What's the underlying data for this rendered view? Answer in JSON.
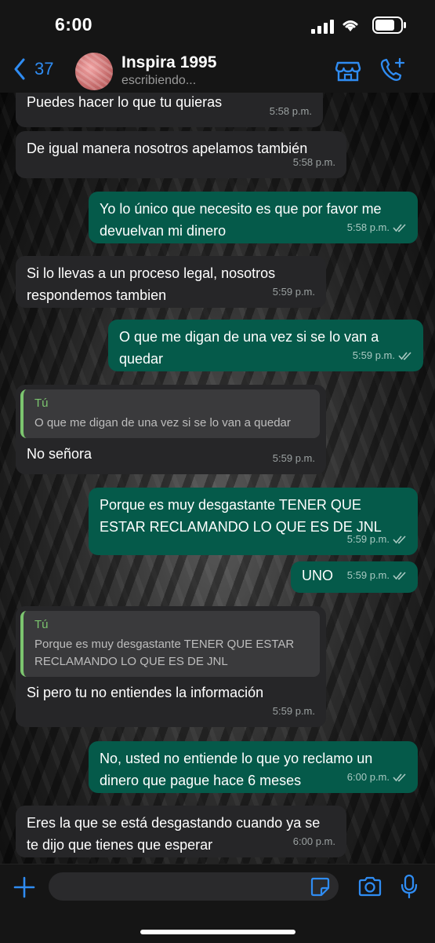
{
  "status_bar": {
    "time": "6:00"
  },
  "header": {
    "back_count": "37",
    "contact_name": "Inspira 1995",
    "contact_status": "escribiendo..."
  },
  "messages": [
    {
      "dir": "in",
      "text": "Puedes hacer lo que tu quieras",
      "time": "5:58 p.m."
    },
    {
      "dir": "in",
      "text": "De igual manera nosotros apelamos también",
      "time": "5:58 p.m."
    },
    {
      "dir": "out",
      "text": "Yo lo único que necesito es que por favor me devuelvan mi dinero",
      "time": "5:58 p.m."
    },
    {
      "dir": "in",
      "text": "Si lo llevas a un proceso legal, nosotros respondemos tambien",
      "time": "5:59 p.m."
    },
    {
      "dir": "out",
      "text": "O que me digan de una vez si se lo van a quedar",
      "time": "5:59 p.m."
    },
    {
      "dir": "in",
      "quote_author": "Tú",
      "quote_text": "O que me digan de una vez si se lo van a quedar",
      "text": "No señora",
      "time": "5:59 p.m."
    },
    {
      "dir": "out",
      "text": "Porque es muy desgastante TENER QUE ESTAR RECLAMANDO LO QUE ES DE JNL",
      "time": "5:59 p.m."
    },
    {
      "dir": "out",
      "text": "UNO",
      "time": "5:59 p.m."
    },
    {
      "dir": "in",
      "quote_author": "Tú",
      "quote_text": "Porque es muy desgastante TENER QUE ESTAR RECLAMANDO LO QUE ES DE JNL",
      "text": "Si pero tu no entiendes la información",
      "time": "5:59 p.m."
    },
    {
      "dir": "out",
      "text": "No, usted no entiende lo que yo reclamo un dinero que pague hace 6 meses",
      "time": "6:00 p.m."
    },
    {
      "dir": "in",
      "text": "Eres la que se está desgastando cuando ya se te dijo que tienes que esperar",
      "time": "6:00 p.m."
    }
  ],
  "composer": {
    "placeholder": ""
  },
  "colors": {
    "accent": "#2f8cf2",
    "outgoing": "#055a4a",
    "incoming": "#262628",
    "quote_bar": "#7cc56f"
  },
  "icons": [
    "chevron-left-icon",
    "store-icon",
    "phone-add-icon",
    "plus-icon",
    "sticker-icon",
    "camera-icon",
    "microphone-icon",
    "double-check-icon"
  ]
}
